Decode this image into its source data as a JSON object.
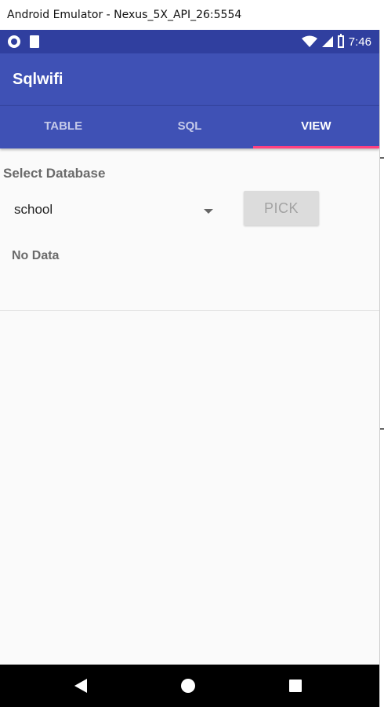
{
  "window": {
    "title": "Android Emulator - Nexus_5X_API_26:5554"
  },
  "status_bar": {
    "time": "7:46",
    "icons": [
      "notification-dot-icon",
      "sd-card-icon",
      "wifi-icon",
      "signal-icon",
      "battery-icon"
    ]
  },
  "app_bar": {
    "title": "Sqlwifi"
  },
  "tabs": [
    {
      "label": "TABLE",
      "active": false
    },
    {
      "label": "SQL",
      "active": false
    },
    {
      "label": "VIEW",
      "active": true
    }
  ],
  "content": {
    "select_label": "Select Database",
    "database_value": "school",
    "pick_label": "PICK",
    "empty_message": "No Data"
  },
  "nav_bar": {
    "icons": [
      "back-icon",
      "home-icon",
      "recents-icon"
    ]
  },
  "colors": {
    "status_bar": "#303f9f",
    "primary": "#3f51b5",
    "accent": "#ff4081",
    "background": "#fafafa"
  }
}
